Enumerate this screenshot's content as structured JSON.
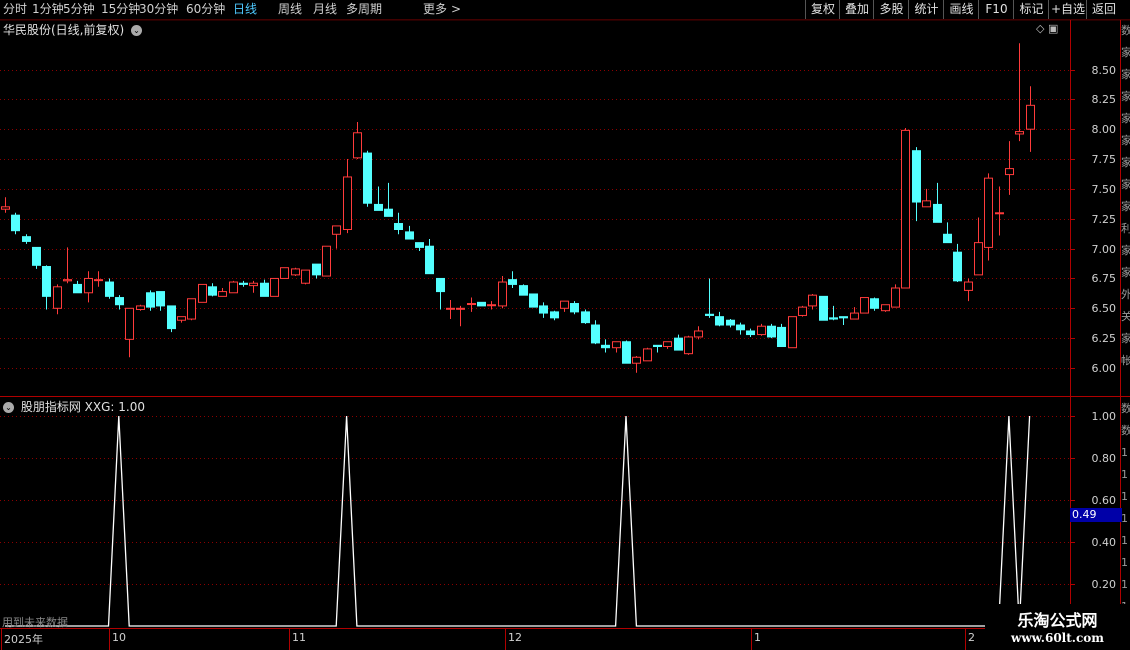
{
  "toolbar": {
    "periods": [
      "分时",
      "1分钟",
      "5分钟",
      "15分钟",
      "30分钟",
      "60分钟",
      "日线",
      "周线",
      "月线",
      "多周期",
      "更多"
    ],
    "active_period": "日线",
    "more_chevron": ">",
    "actions": [
      "复权",
      "叠加",
      "多股",
      "统计",
      "画线",
      "F10",
      "标记",
      "+自选",
      "返回"
    ]
  },
  "main_panel": {
    "title": "华民股份(日线,前复权)",
    "up_color": "#ff3b3b",
    "down_color": "#54ffff",
    "grid_color": "#8b0000",
    "price_ticks": [
      "8.50",
      "8.25",
      "8.00",
      "7.75",
      "7.50",
      "7.25",
      "7.00",
      "6.75",
      "6.50",
      "6.25",
      "6.00"
    ]
  },
  "indicator_panel": {
    "name": "股朋指标网",
    "series_label": "XXG: 1.00",
    "ticks": [
      "1.00",
      "0.80",
      "0.60",
      "0.40",
      "0.20"
    ],
    "cursor_value": "0.49",
    "warning": "用到未来数据",
    "line_color": "#ffffff"
  },
  "date_axis": {
    "labels": [
      "2025年",
      "10",
      "11",
      "12",
      "1",
      "2"
    ]
  },
  "watermark": {
    "name": "乐淘公式网",
    "url": "www.60lt.com"
  },
  "side_strip_glyphs": [
    "数",
    "家",
    "家",
    "家",
    "家",
    "家",
    "家",
    "家",
    "家",
    "利",
    "家",
    "家",
    "外",
    "关",
    "家",
    "帐"
  ],
  "side_strip2_glyphs": [
    "数",
    "数",
    "1",
    "1",
    "1",
    "1",
    "1",
    "1",
    "1",
    "1"
  ],
  "chart_data": [
    {
      "type": "candlestick",
      "title": "华民股份(日线,前复权)",
      "ylim": [
        5.9,
        8.8
      ],
      "up_color": "#ff3b3b",
      "down_color": "#54ffff",
      "candles": [
        [
          7.33,
          7.43,
          7.3,
          7.35
        ],
        [
          7.28,
          7.3,
          7.12,
          7.15
        ],
        [
          7.1,
          7.12,
          7.04,
          7.06
        ],
        [
          7.01,
          7.01,
          6.83,
          6.86
        ],
        [
          6.85,
          6.86,
          6.49,
          6.6
        ],
        [
          6.5,
          6.7,
          6.45,
          6.68
        ],
        [
          6.73,
          7.01,
          6.71,
          6.74
        ],
        [
          6.7,
          6.73,
          6.63,
          6.63
        ],
        [
          6.63,
          6.81,
          6.55,
          6.75
        ],
        [
          6.74,
          6.81,
          6.68,
          6.74
        ],
        [
          6.72,
          6.75,
          6.58,
          6.6
        ],
        [
          6.59,
          6.61,
          6.49,
          6.53
        ],
        [
          6.24,
          6.5,
          6.09,
          6.5
        ],
        [
          6.49,
          6.53,
          6.48,
          6.52
        ],
        [
          6.63,
          6.65,
          6.48,
          6.51
        ],
        [
          6.64,
          6.64,
          6.48,
          6.52
        ],
        [
          6.52,
          6.52,
          6.3,
          6.33
        ],
        [
          6.4,
          6.43,
          6.38,
          6.43
        ],
        [
          6.41,
          6.58,
          6.4,
          6.58
        ],
        [
          6.55,
          6.7,
          6.55,
          6.7
        ],
        [
          6.68,
          6.71,
          6.6,
          6.61
        ],
        [
          6.6,
          6.67,
          6.6,
          6.64
        ],
        [
          6.63,
          6.73,
          6.63,
          6.72
        ],
        [
          6.71,
          6.73,
          6.68,
          6.7
        ],
        [
          6.69,
          6.73,
          6.63,
          6.71
        ],
        [
          6.71,
          6.74,
          6.6,
          6.6
        ],
        [
          6.6,
          6.75,
          6.6,
          6.75
        ],
        [
          6.75,
          6.84,
          6.75,
          6.84
        ],
        [
          6.78,
          6.84,
          6.77,
          6.83
        ],
        [
          6.71,
          6.82,
          6.7,
          6.82
        ],
        [
          6.87,
          6.87,
          6.75,
          6.78
        ],
        [
          6.77,
          7.02,
          6.77,
          7.02
        ],
        [
          7.12,
          7.19,
          7.0,
          7.19
        ],
        [
          7.16,
          7.75,
          7.13,
          7.6
        ],
        [
          7.76,
          8.06,
          7.75,
          7.97
        ],
        [
          7.8,
          7.82,
          7.35,
          7.38
        ],
        [
          7.37,
          7.52,
          7.32,
          7.32
        ],
        [
          7.33,
          7.55,
          7.27,
          7.27
        ],
        [
          7.21,
          7.3,
          7.12,
          7.16
        ],
        [
          7.14,
          7.19,
          7.08,
          7.08
        ],
        [
          7.05,
          7.05,
          6.98,
          7.01
        ],
        [
          7.02,
          7.08,
          6.79,
          6.79
        ],
        [
          6.75,
          6.75,
          6.49,
          6.64
        ],
        [
          6.5,
          6.57,
          6.41,
          6.5
        ],
        [
          6.5,
          6.52,
          6.35,
          6.5
        ],
        [
          6.54,
          6.59,
          6.47,
          6.54
        ],
        [
          6.55,
          6.55,
          6.52,
          6.52
        ],
        [
          6.53,
          6.56,
          6.49,
          6.53
        ],
        [
          6.52,
          6.77,
          6.5,
          6.72
        ],
        [
          6.74,
          6.81,
          6.67,
          6.7
        ],
        [
          6.69,
          6.7,
          6.61,
          6.61
        ],
        [
          6.62,
          6.62,
          6.51,
          6.51
        ],
        [
          6.52,
          6.55,
          6.42,
          6.46
        ],
        [
          6.47,
          6.48,
          6.4,
          6.42
        ],
        [
          6.5,
          6.56,
          6.47,
          6.56
        ],
        [
          6.54,
          6.56,
          6.45,
          6.47
        ],
        [
          6.47,
          6.49,
          6.37,
          6.38
        ],
        [
          6.36,
          6.4,
          6.2,
          6.21
        ],
        [
          6.19,
          6.24,
          6.13,
          6.17
        ],
        [
          6.17,
          6.22,
          6.13,
          6.22
        ],
        [
          6.22,
          6.23,
          6.04,
          6.04
        ],
        [
          6.04,
          6.1,
          5.96,
          6.09
        ],
        [
          6.06,
          6.17,
          6.06,
          6.16
        ],
        [
          6.19,
          6.19,
          6.13,
          6.18
        ],
        [
          6.18,
          6.22,
          6.16,
          6.22
        ],
        [
          6.25,
          6.28,
          6.15,
          6.15
        ],
        [
          6.12,
          6.27,
          6.11,
          6.26
        ],
        [
          6.26,
          6.35,
          6.24,
          6.31
        ],
        [
          6.45,
          6.75,
          6.42,
          6.44
        ],
        [
          6.43,
          6.47,
          6.35,
          6.36
        ],
        [
          6.4,
          6.41,
          6.34,
          6.36
        ],
        [
          6.36,
          6.38,
          6.28,
          6.32
        ],
        [
          6.31,
          6.33,
          6.26,
          6.28
        ],
        [
          6.28,
          6.37,
          6.27,
          6.35
        ],
        [
          6.35,
          6.37,
          6.25,
          6.26
        ],
        [
          6.34,
          6.37,
          6.18,
          6.18
        ],
        [
          6.17,
          6.43,
          6.17,
          6.43
        ],
        [
          6.44,
          6.52,
          6.43,
          6.51
        ],
        [
          6.52,
          6.62,
          6.49,
          6.61
        ],
        [
          6.6,
          6.6,
          6.41,
          6.4
        ],
        [
          6.42,
          6.52,
          6.4,
          6.41
        ],
        [
          6.43,
          6.43,
          6.36,
          6.42
        ],
        [
          6.41,
          6.51,
          6.41,
          6.46
        ],
        [
          6.46,
          6.59,
          6.46,
          6.59
        ],
        [
          6.58,
          6.59,
          6.48,
          6.5
        ],
        [
          6.48,
          6.53,
          6.47,
          6.53
        ],
        [
          6.51,
          6.7,
          6.51,
          6.67
        ],
        [
          6.67,
          8.01,
          6.67,
          7.99
        ],
        [
          7.82,
          7.85,
          7.23,
          7.39
        ],
        [
          7.35,
          7.5,
          7.36,
          7.4
        ],
        [
          7.37,
          7.55,
          7.22,
          7.22
        ],
        [
          7.12,
          7.22,
          7.05,
          7.05
        ],
        [
          6.97,
          7.04,
          6.72,
          6.73
        ],
        [
          6.65,
          6.75,
          6.56,
          6.72
        ],
        [
          6.78,
          7.26,
          6.78,
          7.05
        ],
        [
          7.01,
          7.63,
          6.9,
          7.59
        ],
        [
          7.3,
          7.52,
          7.11,
          7.3
        ],
        [
          7.62,
          7.9,
          7.45,
          7.67
        ],
        [
          7.96,
          8.72,
          7.9,
          7.98
        ],
        [
          8.0,
          8.36,
          7.81,
          8.2
        ]
      ]
    },
    {
      "type": "line",
      "title": "股朋指标网",
      "series": [
        {
          "name": "XXG",
          "peaks_at_index": [
            11,
            33,
            60,
            97
          ],
          "last_value": 1.0
        }
      ],
      "ylim": [
        0,
        1.0
      ]
    }
  ]
}
